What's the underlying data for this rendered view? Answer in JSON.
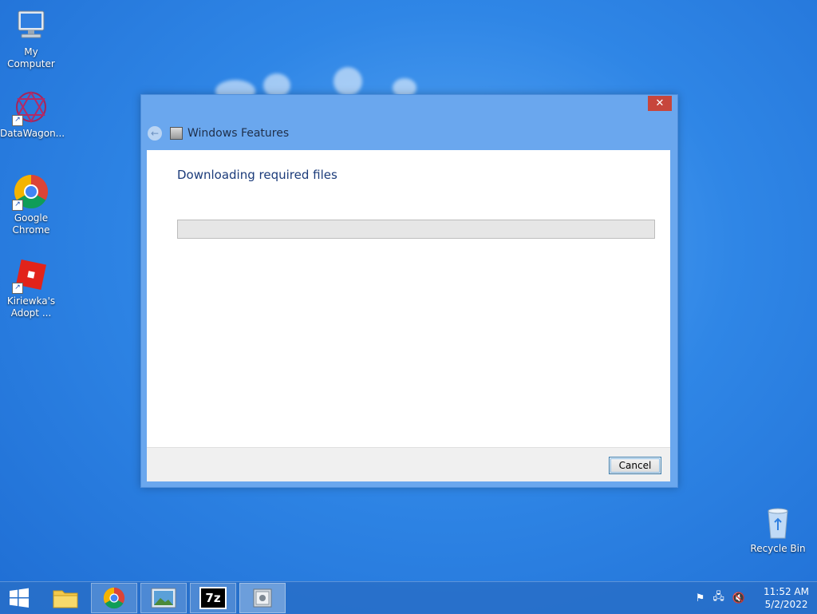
{
  "desktop": {
    "icons": [
      {
        "label": "My Computer",
        "icon": "computer-icon"
      },
      {
        "label": "DataWagon...",
        "icon": "datawagon-icon"
      },
      {
        "label": "Google Chrome",
        "icon": "chrome-icon"
      },
      {
        "label": "Kiriewka's Adopt ...",
        "icon": "roblox-icon"
      },
      {
        "label": "Recycle Bin",
        "icon": "recycle-bin-icon"
      }
    ]
  },
  "dialog": {
    "title": "Windows Features",
    "close_glyph": "✕",
    "heading": "Downloading required files",
    "progress": 0,
    "cancel_label": "Cancel"
  },
  "taskbar": {
    "items": [
      "start-icon",
      "file-explorer-icon",
      "chrome-icon",
      "photos-icon",
      "7zip-icon",
      "windows-features-icon"
    ],
    "sevenzip_label": "7z"
  },
  "tray": {
    "time": "11:52 AM",
    "date": "5/2/2022"
  },
  "colors": {
    "accent": "#1b3b7a",
    "close": "#c7463c",
    "dialog_frame": "#6aa7ee"
  }
}
